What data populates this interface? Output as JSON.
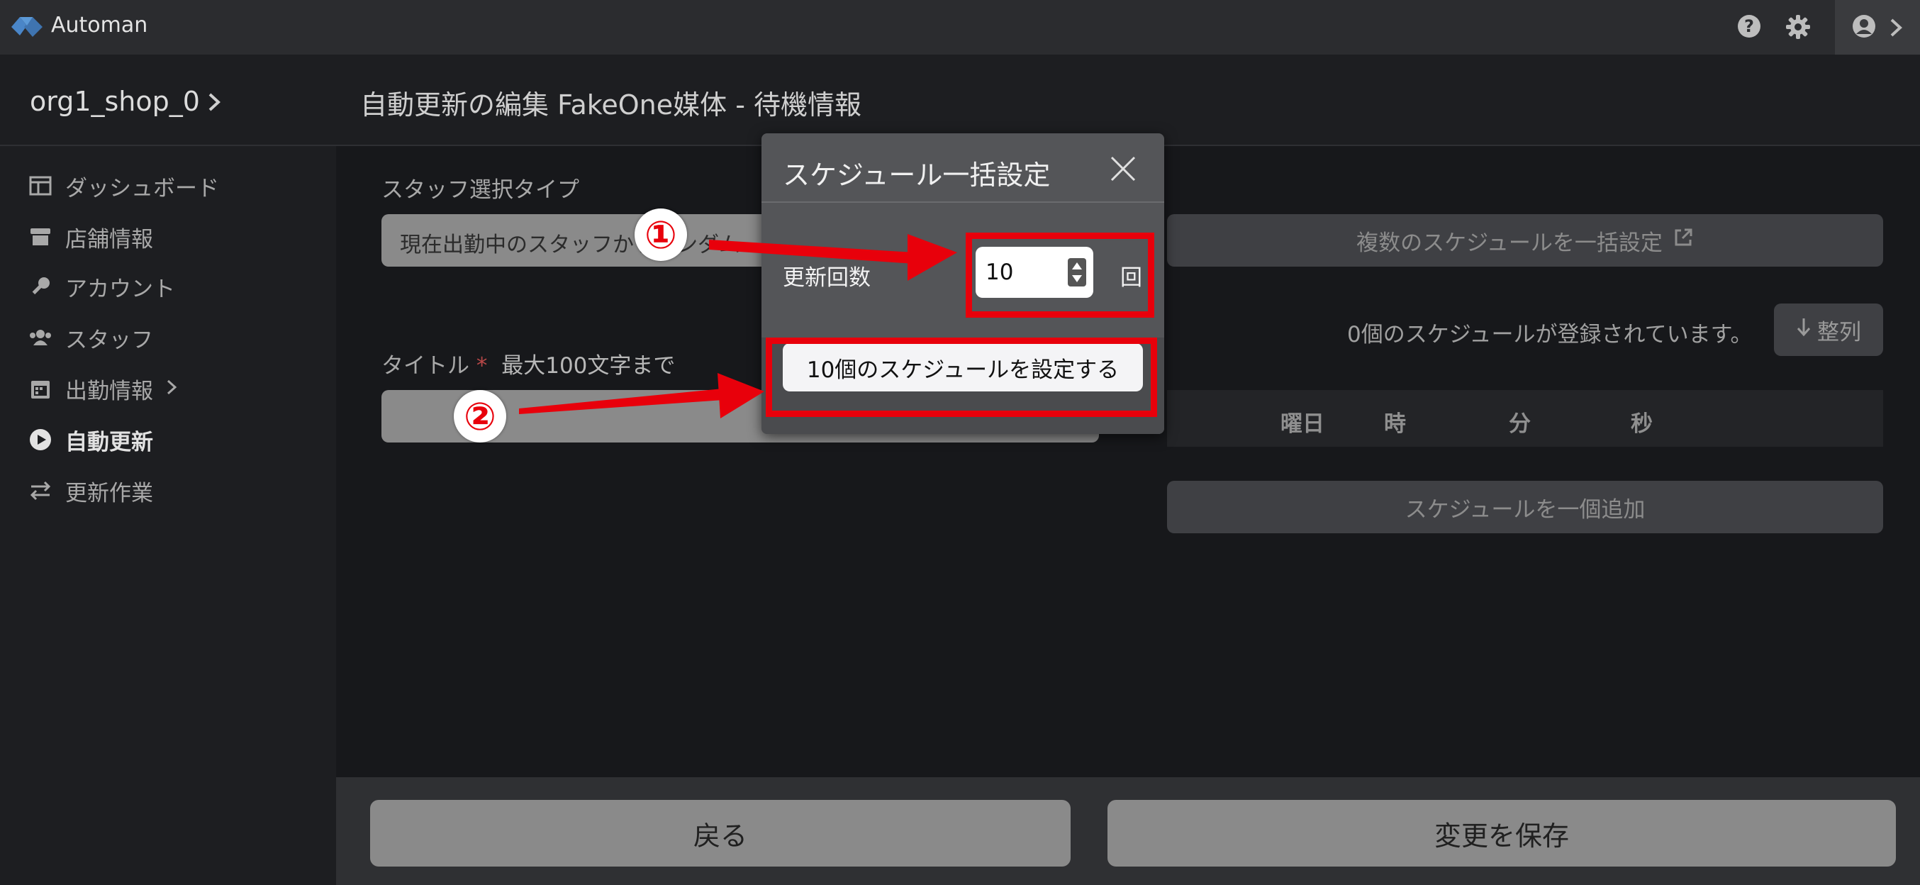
{
  "app": {
    "title": "Automan",
    "logo": "automan-logo-icon"
  },
  "topbar": {
    "icons": [
      "help-icon",
      "gear-icon",
      "user-icon",
      "chevron-right-icon"
    ]
  },
  "sidebar": {
    "shop_name": "org1_shop_0",
    "items": [
      {
        "label": "ダッシュボード",
        "icon": "dashboard-icon"
      },
      {
        "label": "店舗情報",
        "icon": "store-icon"
      },
      {
        "label": "アカウント",
        "icon": "key-icon"
      },
      {
        "label": "スタッフ",
        "icon": "users-icon"
      },
      {
        "label": "出勤情報",
        "icon": "calendar-icon"
      },
      {
        "label": "自動更新",
        "icon": "play-icon",
        "active": true
      },
      {
        "label": "更新作業",
        "icon": "exchange-icon"
      }
    ]
  },
  "header": {
    "title": "自動更新の編集 FakeOne媒体 - 待機情報"
  },
  "form": {
    "staff_type_label": "スタッフ選択タイプ",
    "staff_type_value": "現在出勤中のスタッフからランダム",
    "title_label": "タイトル",
    "title_required": "*",
    "title_hint": "最大100文字まで",
    "title_value": ""
  },
  "schedule": {
    "bulk_button": "複数のスケジュールを一括設定",
    "status": "0個のスケジュールが登録されています。",
    "sort_button": "整列",
    "columns": [
      "曜日",
      "時",
      "分",
      "秒"
    ],
    "add_button": "スケジュールを一個追加"
  },
  "footer": {
    "back_button": "戻る",
    "save_button": "変更を保存"
  },
  "modal": {
    "title": "スケジュール一括設定",
    "count_label": "更新回数",
    "count_value": "10",
    "count_unit": "回",
    "submit_button": "10個のスケジュールを設定する"
  },
  "annotations": {
    "marker1": "①",
    "marker2": "②",
    "color": "#e8000b"
  }
}
